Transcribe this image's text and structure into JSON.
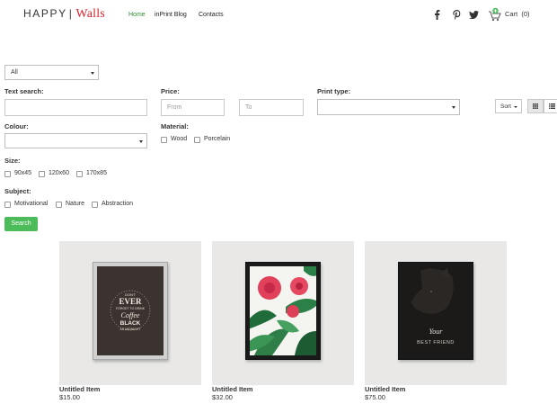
{
  "header": {
    "logo_primary": "HAPPY",
    "logo_separator": "|",
    "logo_secondary": "Walls",
    "nav": [
      {
        "label": "Home",
        "active": true
      },
      {
        "label": "inPrint Blog",
        "active": false
      },
      {
        "label": "Contacts",
        "active": false
      }
    ],
    "social_icons": [
      "facebook-icon",
      "pinterest-icon",
      "twitter-icon"
    ],
    "cart_label": "Cart",
    "cart_count": "(0)"
  },
  "filters": {
    "category_select": "All",
    "text_search_label": "Text search:",
    "price_label": "Price:",
    "price_from_placeholder": "From",
    "price_to_placeholder": "To",
    "print_type_label": "Print type:",
    "sort_label": "Sort",
    "colour_label": "Colour:",
    "material_label": "Material:",
    "materials": [
      "Wood",
      "Porcelain"
    ],
    "size_label": "Size:",
    "sizes": [
      "90x45",
      "120x60",
      "170x85"
    ],
    "subject_label": "Subject:",
    "subjects": [
      "Motivational",
      "Nature",
      "Abstraction"
    ],
    "search_button": "Search"
  },
  "products": [
    {
      "title": "Untitled Item",
      "price": "$15.00",
      "art_lines": [
        "DON'T",
        "EVER",
        "FORGET TO DRINK",
        "Coffee",
        "BLACK",
        "AS MIDNIGHT"
      ]
    },
    {
      "title": "Untitled Item",
      "price": "$32.00"
    },
    {
      "title": "Untitled Item",
      "price": "$75.00",
      "art_lines": [
        "Your",
        "BEST FRIEND"
      ]
    }
  ],
  "colors": {
    "accent_green": "#4cbb5a",
    "nav_active": "#2e8b2e",
    "logo_red": "#d9232d"
  }
}
